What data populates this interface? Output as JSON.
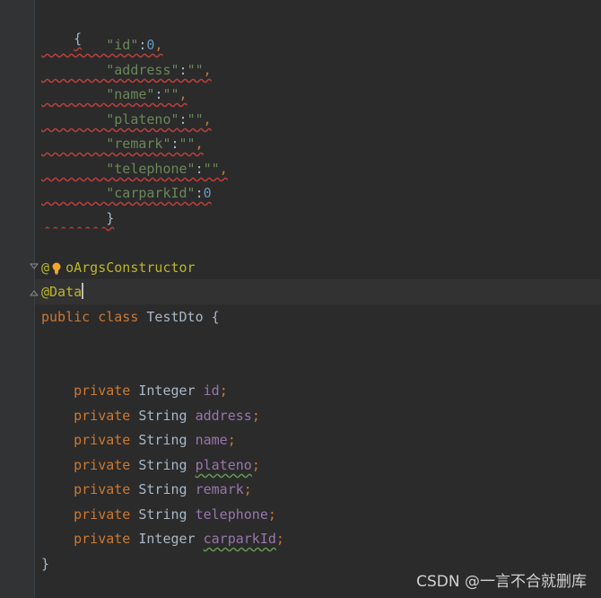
{
  "json_block": {
    "open_brace": "{",
    "fields": [
      {
        "key": "\"id\"",
        "value": "0",
        "type": "num",
        "comma": ","
      },
      {
        "key": "\"address\"",
        "value": "\"\"",
        "type": "str",
        "comma": ","
      },
      {
        "key": "\"name\"",
        "value": "\"\"",
        "type": "str",
        "comma": ","
      },
      {
        "key": "\"plateno\"",
        "value": "\"\"",
        "type": "str",
        "comma": ","
      },
      {
        "key": "\"remark\"",
        "value": "\"\"",
        "type": "str",
        "comma": ","
      },
      {
        "key": "\"telephone\"",
        "value": "\"\"",
        "type": "str",
        "comma": ","
      },
      {
        "key": "\"carparkId\"",
        "value": "0",
        "type": "num",
        "comma": ""
      }
    ],
    "close_brace": "}"
  },
  "annotations": {
    "no_args_at": "@",
    "no_args_rest": "oArgsConstructor",
    "data": "@Data"
  },
  "class_decl": {
    "public": "public",
    "class_kw": "class",
    "name": "TestDto",
    "brace": "{"
  },
  "members": [
    {
      "modifier": "private",
      "type": "Integer",
      "name": "id"
    },
    {
      "modifier": "private",
      "type": "String",
      "name": "address"
    },
    {
      "modifier": "private",
      "type": "String",
      "name": "name"
    },
    {
      "modifier": "private",
      "type": "String",
      "name": "plateno"
    },
    {
      "modifier": "private",
      "type": "String",
      "name": "remark"
    },
    {
      "modifier": "private",
      "type": "String",
      "name": "telephone"
    },
    {
      "modifier": "private",
      "type": "Integer",
      "name": "carparkId"
    }
  ],
  "semicolon": ";",
  "class_close": "}",
  "watermark": "CSDN @一言不合就删库",
  "colors": {
    "background": "#2b2b2b",
    "keyword": "#cc7832",
    "string": "#6a8759",
    "number": "#6897bb",
    "annotation": "#bbb529",
    "field": "#9876aa",
    "plain": "#a9b7c6"
  }
}
